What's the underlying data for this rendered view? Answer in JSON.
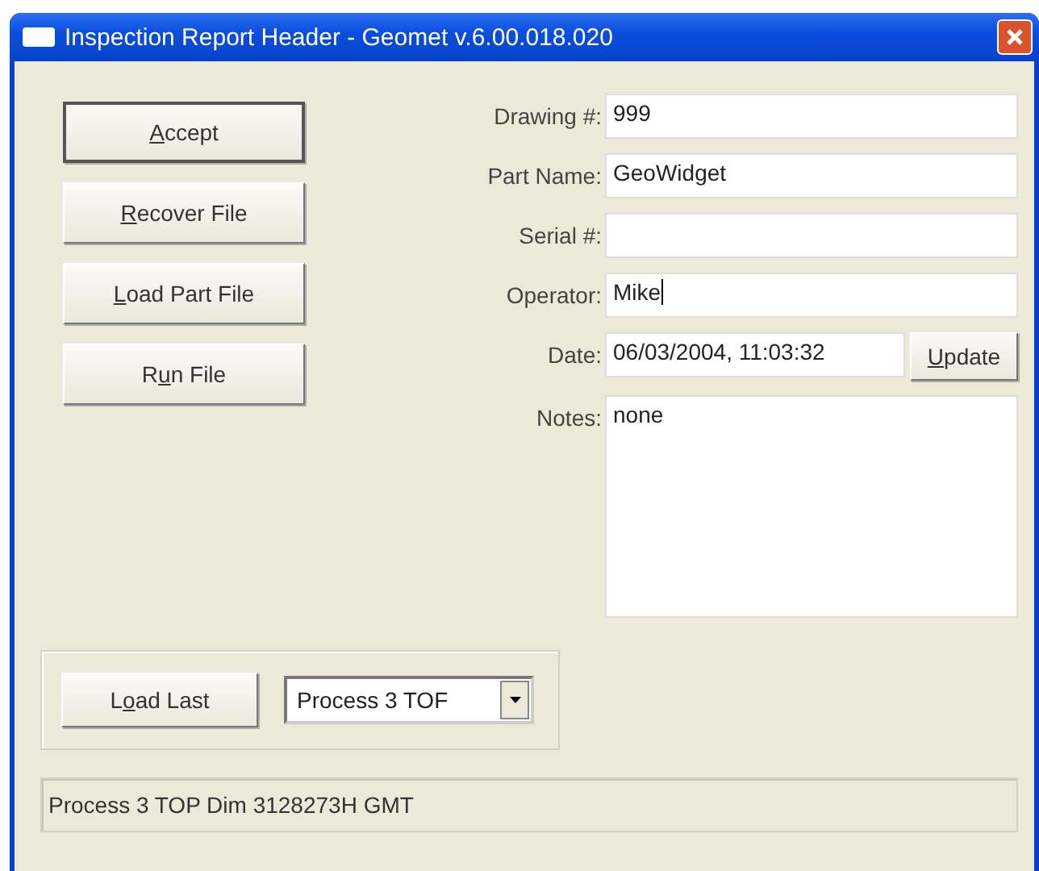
{
  "window": {
    "title": "Inspection Report Header - Geomet v.6.00.018.020"
  },
  "actions": [
    {
      "label": {
        "key": "A",
        "rest": "ccept"
      },
      "default": true
    },
    {
      "label": {
        "key": "R",
        "rest": "ecover File"
      },
      "default": false
    },
    {
      "label": {
        "key": "L",
        "rest": "oad Part File"
      },
      "default": false
    },
    {
      "label": {
        "before": "R",
        "key": "u",
        "rest": "n File"
      },
      "default": false
    }
  ],
  "fields": [
    {
      "kind": "text",
      "label": "Drawing #:",
      "value": "999"
    },
    {
      "kind": "text",
      "label": "Part Name:",
      "value": "GeoWidget"
    },
    {
      "kind": "text",
      "label": "Serial #:"
    },
    {
      "kind": "text",
      "label": "Operator:",
      "value": "Mike",
      "focused": true
    },
    {
      "kind": "date",
      "label": "Date:",
      "value": "06/03/2004, 11:03:32",
      "button_label": {
        "key": "U",
        "rest": "pdate"
      }
    },
    {
      "kind": "notes",
      "label": "Notes:",
      "value": "none"
    }
  ],
  "load_group": {
    "button_label": {
      "before": "L",
      "key": "o",
      "rest": "ad Last"
    },
    "combo_value": "Process 3 TOF"
  },
  "status_bar": "Process 3 TOP Dim 3128273H GMT"
}
